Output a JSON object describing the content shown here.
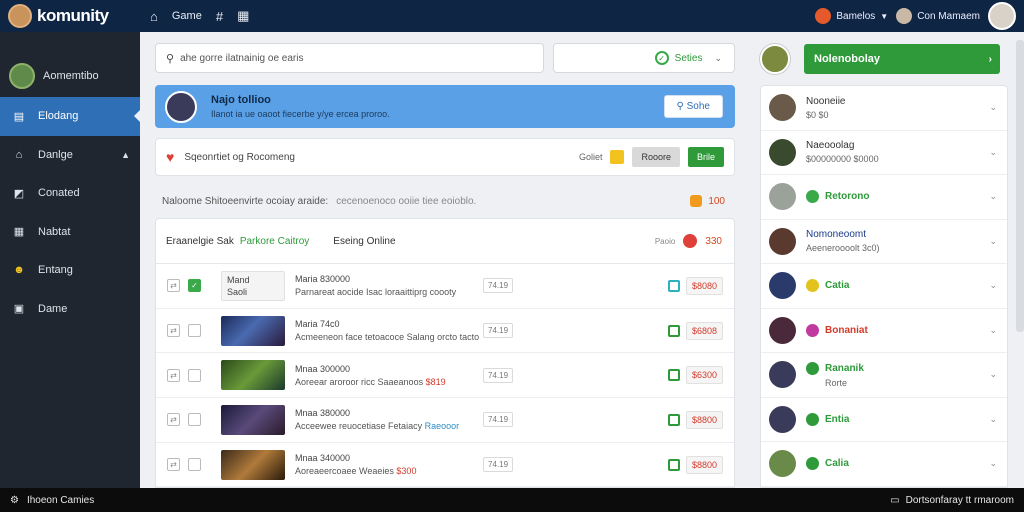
{
  "topbar": {
    "logo_text": "komunity",
    "nav": [
      {
        "icon": "home-icon",
        "label": ""
      },
      {
        "icon": "",
        "label": "Game"
      },
      {
        "icon": "hashtag-icon",
        "label": ""
      },
      {
        "icon": "grid-icon",
        "label": ""
      }
    ],
    "chip1_label": "Bamelos",
    "chip2_label": "Con Mamaem"
  },
  "sidebar": {
    "profile_label": "Aomemtibo",
    "items": [
      {
        "label": "Elodang",
        "icon": "list-icon",
        "active": true
      },
      {
        "label": "Danlge",
        "icon": "home-icon",
        "active": false
      },
      {
        "label": "Conated",
        "icon": "chart-icon",
        "active": false
      },
      {
        "label": "Nabtat",
        "icon": "grid-icon",
        "active": false
      },
      {
        "label": "Entang",
        "icon": "smile-icon",
        "active": false
      },
      {
        "label": "Dame",
        "icon": "image-icon",
        "active": false
      }
    ]
  },
  "statusbar": {
    "left": "Ihoeon Camies",
    "right": "Dortsonfaray tt rmaroom"
  },
  "search": {
    "value": "ahe gorre ilatnainig oe earis"
  },
  "filter": {
    "label": "Seties"
  },
  "banner": {
    "title": "Najo tollioo",
    "subtitle": "Ilanot ia ue oaoot fiecerbe y/ye ercea proroo.",
    "button": "Sohe"
  },
  "notice": {
    "text": "Sqeonrtiet og Rocomeng",
    "mini": "Goliet",
    "btn_gray": "Rooore",
    "btn_green": "Brile"
  },
  "section": {
    "title": "Naloome Shitoeenvirte ocoiay araide:",
    "subtitle": "cecenoenoco ooiie tiee eoioblo.",
    "count": "100"
  },
  "list_header": {
    "a": "Eraanelgie Sak",
    "b": "Parkore Caitroy",
    "c": "Eseing Online",
    "mini": "Paoio",
    "count": "330"
  },
  "rows": [
    {
      "checked": true,
      "thumb_text": [
        "Mand",
        "Saoli"
      ],
      "title": "Maria 830000",
      "desc": "Parnareat aocide Isac loraaittiprg coooty",
      "desc_extra": "",
      "pill": "74.19",
      "icon": "teal",
      "price": "$8080"
    },
    {
      "checked": false,
      "thumb_text": [],
      "title": "Maria 74c0",
      "desc": "Acmeeneon face tetoacoce Salang orcto tacto",
      "desc_extra": "",
      "pill": "74.19",
      "icon": "green",
      "price": "$6808"
    },
    {
      "checked": false,
      "thumb_text": [],
      "title": "Mnaa 300000",
      "desc": "Aoreear aroroor ricc Saaeanoos",
      "desc_extra": "$819",
      "pill": "74.19",
      "icon": "green",
      "price": "$6300"
    },
    {
      "checked": false,
      "thumb_text": [],
      "title": "Mnaa 380000",
      "desc": "Acceewee reuocetiase Fetaiacy",
      "desc_extra": "Raeooor",
      "pill": "74.19",
      "icon": "green",
      "price": "$8800"
    },
    {
      "checked": false,
      "thumb_text": [],
      "title": "Mnaa 340000",
      "desc": "Aoreaeercoaee Weaeies",
      "desc_extra": "$300",
      "pill": "74.19",
      "icon": "green",
      "price": "$8800"
    }
  ],
  "right_header": {
    "button": "Nolenobolay"
  },
  "right_items": [
    {
      "name": "Nooneiie",
      "sub": "$0 $0",
      "style": "",
      "avatar_color": "#6a5a4a"
    },
    {
      "name": "Naeooolag",
      "sub": "$00000000 $0000",
      "style": "",
      "avatar_color": "#3a4a2e"
    },
    {
      "name": "Retorono",
      "sub": "",
      "style": "green",
      "avatar_color": "#9aa29a"
    },
    {
      "name": "Nomoneoomt",
      "sub": "Aeeneroooolt 3c0)",
      "style": "blue",
      "avatar_color": "#5a3a2e"
    },
    {
      "name": "Catia",
      "sub": "",
      "style": "green",
      "avatar_color": "#2a3a6a"
    },
    {
      "name": "Bonaniat",
      "sub": "",
      "style": "red",
      "avatar_color": "#4a2a3a"
    },
    {
      "name": "Rananik",
      "sub": "Rorte",
      "style": "green",
      "avatar_color": "#3a3a5a"
    },
    {
      "name": "Entia",
      "sub": "",
      "style": "green",
      "avatar_color": "#3a3a5a"
    },
    {
      "name": "Calia",
      "sub": "",
      "style": "green",
      "avatar_color": "#6a8a4a"
    }
  ],
  "colors": {
    "accent": "#2f6fb6",
    "green": "#2e9a3a",
    "topbar": "#0f2544",
    "sidebar": "#1f262f"
  }
}
